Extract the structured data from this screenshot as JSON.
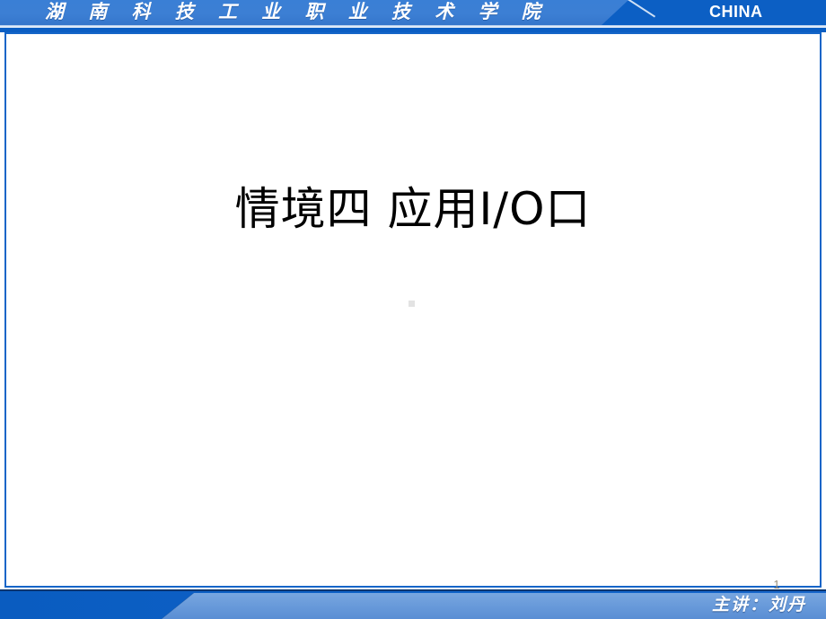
{
  "slide": {
    "header": {
      "school_name": "湖 南 科 技 工 业 职 业 技 术 学 院",
      "region_label": "CHINA",
      "background_color": "#3a7fd5",
      "accent_color": "#0c5fc4"
    },
    "body": {
      "title": "情境四 应用I/O口"
    },
    "footer": {
      "presenter": "主讲：刘丹",
      "page_number": "1",
      "base_color": "#0e62c8",
      "wedge_color": "#6b9cdb"
    }
  }
}
